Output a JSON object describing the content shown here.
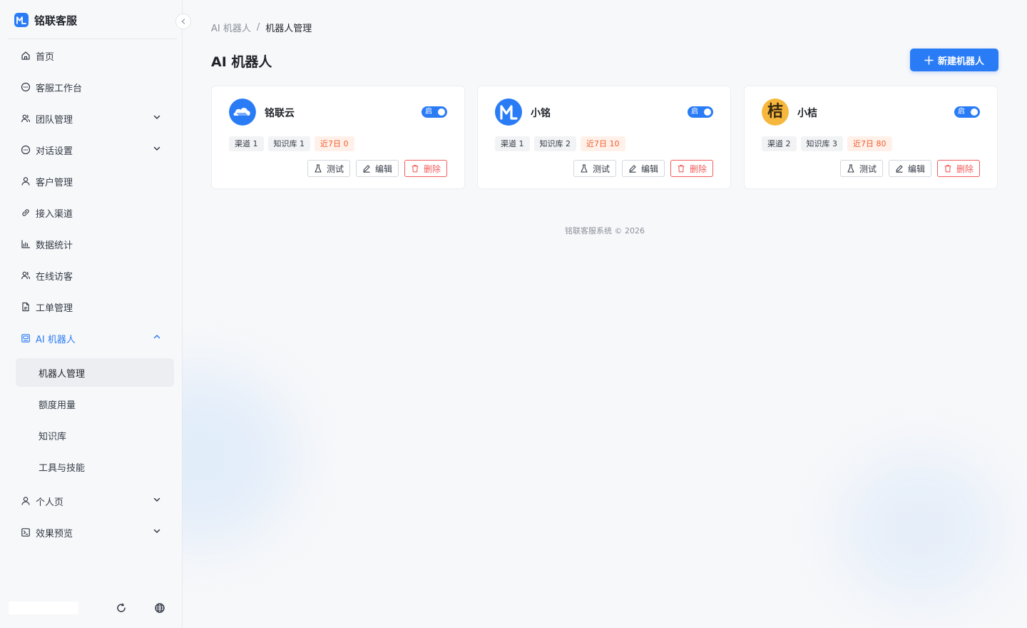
{
  "brand": {
    "name": "铭联客服",
    "logo_letter": "M"
  },
  "sidebar": {
    "items": [
      {
        "label": "首页",
        "icon": "home-icon",
        "expandable": false
      },
      {
        "label": "客服工作台",
        "icon": "chat-bubble-icon",
        "expandable": false
      },
      {
        "label": "团队管理",
        "icon": "team-icon",
        "expandable": true
      },
      {
        "label": "对话设置",
        "icon": "chat-bubble-icon",
        "expandable": true
      },
      {
        "label": "客户管理",
        "icon": "user-icon",
        "expandable": false
      },
      {
        "label": "接入渠道",
        "icon": "link-icon",
        "expandable": false
      },
      {
        "label": "数据统计",
        "icon": "bar-chart-icon",
        "expandable": false
      },
      {
        "label": "在线访客",
        "icon": "team-icon",
        "expandable": false
      },
      {
        "label": "工单管理",
        "icon": "document-icon",
        "expandable": false
      },
      {
        "label": "AI 机器人",
        "icon": "robot-icon",
        "expandable": true,
        "expanded": true,
        "active": true
      },
      {
        "label": "个人页",
        "icon": "user-icon",
        "expandable": true
      },
      {
        "label": "效果预览",
        "icon": "preview-icon",
        "expandable": true
      }
    ],
    "ai_subitems": [
      {
        "label": "机器人管理",
        "selected": true
      },
      {
        "label": "额度用量"
      },
      {
        "label": "知识库"
      },
      {
        "label": "工具与技能"
      }
    ]
  },
  "breadcrumb": {
    "parent": "AI 机器人",
    "separator": "/",
    "current": "机器人管理"
  },
  "page": {
    "title": "AI 机器人",
    "new_button_label": "新建机器人"
  },
  "bots": [
    {
      "name": "铭联云",
      "avatar": "cloud-avatar-icon",
      "toggle_label": "启",
      "enabled": true,
      "tags": [
        {
          "text": "渠道 1"
        },
        {
          "text": "知识库 1"
        },
        {
          "text": "近7日 0",
          "warn": true
        }
      ]
    },
    {
      "name": "小铭",
      "avatar": "m-logo-avatar-icon",
      "toggle_label": "启",
      "enabled": true,
      "tags": [
        {
          "text": "渠道 1"
        },
        {
          "text": "知识库 2"
        },
        {
          "text": "近7日 10",
          "warn": true
        }
      ]
    },
    {
      "name": "小桔",
      "avatar": "orange-avatar-icon",
      "avatar_char": "桔",
      "toggle_label": "启",
      "enabled": true,
      "tags": [
        {
          "text": "渠道 2"
        },
        {
          "text": "知识库 3"
        },
        {
          "text": "近7日 80",
          "warn": true
        }
      ]
    }
  ],
  "card_actions": {
    "test": "测试",
    "edit": "编辑",
    "delete": "删除"
  },
  "footer": {
    "copyright": "铭联客服系统 © 2026"
  },
  "colors": {
    "primary": "#2a7cf6",
    "danger": "#f25c5c",
    "warn_text": "#f25c2d",
    "warn_bg": "#fff1ea"
  }
}
